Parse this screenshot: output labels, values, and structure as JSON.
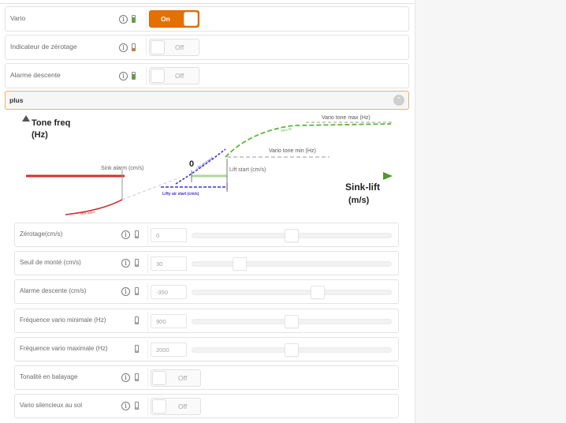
{
  "top_rows": [
    {
      "label": "Vario",
      "toggle": "On",
      "state": "on",
      "battery": "green"
    },
    {
      "label": "Indicateur de zérotage",
      "toggle": "Off",
      "state": "off",
      "battery": "orange"
    },
    {
      "label": "Alarme descente",
      "toggle": "Off",
      "state": "off",
      "battery": "green"
    }
  ],
  "section": {
    "label": "plus",
    "chevron": "chevron-up-icon"
  },
  "diagram": {
    "title_line1": "Tone freq",
    "title_line2": "(Hz)",
    "x_title_line1": "Sink-lift",
    "x_title_line2": "(m/s)",
    "zero": "0",
    "sink_alarm": "Sink alarm (cm/s)",
    "lift_start": "Lift start (cm/s)",
    "lifty_air_start": "Lifty air start (cm/s)",
    "tone_min": "Vario tone min (Hz)",
    "tone_max": "Vario tone max (Hz)",
    "curve_vario": "Vario lift",
    "curve_lifty": "Lifty air sound",
    "curve_sink": "Sink alarm"
  },
  "settings": [
    {
      "label": "Zérotage(cm/s)",
      "type": "slider",
      "value": "0",
      "slider_fraction": 0.5,
      "info": true
    },
    {
      "label": "Seuil de monté (cm/s)",
      "type": "slider",
      "value": "30",
      "slider_fraction": 0.24,
      "info": true
    },
    {
      "label": "Alarme descente (cm/s)",
      "type": "slider",
      "value": "-350",
      "slider_fraction": 0.63,
      "info": true
    },
    {
      "label": "Fréquence vario minimale (Hz)",
      "type": "slider",
      "value": "900",
      "slider_fraction": 0.5,
      "info": false
    },
    {
      "label": "Fréquence vario maximale (Hz)",
      "type": "slider",
      "value": "2000",
      "slider_fraction": 0.5,
      "info": false
    },
    {
      "label": "Tonalité en balayage",
      "type": "toggle",
      "value": "Off",
      "info": true
    },
    {
      "label": "Vario silencieux au sol",
      "type": "toggle",
      "value": "Off",
      "info": true
    }
  ],
  "colors": {
    "accent": "#e57000",
    "battery_green": "#4caf20",
    "battery_orange": "#e8731a",
    "battery_gray": "#b5b5b5",
    "sink_red": "#d32f2f",
    "lift_green": "#5cb83a",
    "lifty_blue": "#3a35c8"
  }
}
